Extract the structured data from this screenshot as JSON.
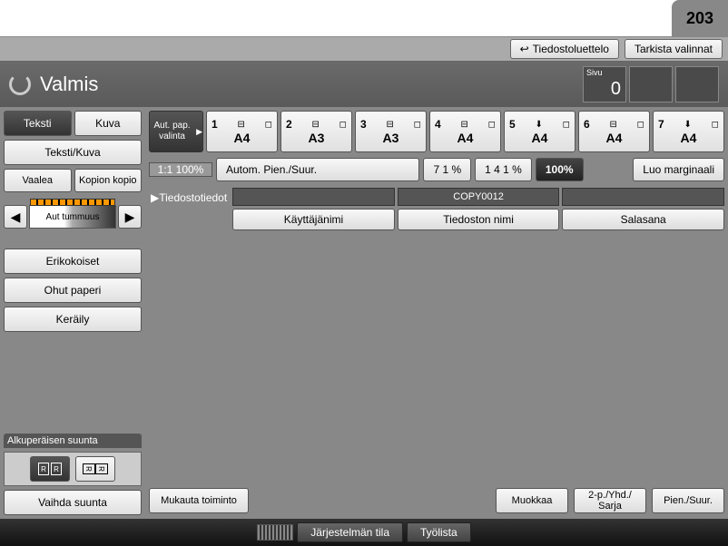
{
  "corner_number": "203",
  "toolbar": {
    "file_list": "Tiedostoluettelo",
    "check_settings": "Tarkista valinnat"
  },
  "status": {
    "text": "Valmis",
    "page_label": "Sivu",
    "page_value": "0"
  },
  "left": {
    "text": "Teksti",
    "image": "Kuva",
    "text_image": "Teksti/Kuva",
    "light": "Vaalea",
    "copy_of_copy": "Kopion kopio",
    "auto_density": "Aut tummuus",
    "mixed_sizes": "Erikokoiset",
    "thin_paper": "Ohut paperi",
    "collate": "Keräily",
    "orientation_header": "Alkuperäisen suunta",
    "change_direction": "Vaihda suunta"
  },
  "trays": {
    "auto_label": "Aut. pap. valinta",
    "items": [
      {
        "num": "1",
        "size": "A4"
      },
      {
        "num": "2",
        "size": "A3"
      },
      {
        "num": "3",
        "size": "A3"
      },
      {
        "num": "4",
        "size": "A4"
      },
      {
        "num": "5",
        "size": "A4"
      },
      {
        "num": "6",
        "size": "A4"
      },
      {
        "num": "7",
        "size": "A4"
      }
    ]
  },
  "zoom": {
    "ratio": "1:1 100%",
    "auto": "Autom. Pien./Suur.",
    "p71": "7 1 %",
    "p141": "1 4 1 %",
    "p100": "100%",
    "margin": "Luo marginaali"
  },
  "file_info": {
    "header": "Tiedostotiedot",
    "filename_value": "COPY0012",
    "username": "Käyttäjänimi",
    "filename": "Tiedoston nimi",
    "password": "Salasana"
  },
  "bottom": {
    "customize": "Mukauta toiminto",
    "edit": "Muokkaa",
    "duplex": "2-p./Yhd./ Sarja",
    "reduce": "Pien./Suur."
  },
  "footer": {
    "system_status": "Järjestelmän tila",
    "job_list": "Työlista"
  }
}
